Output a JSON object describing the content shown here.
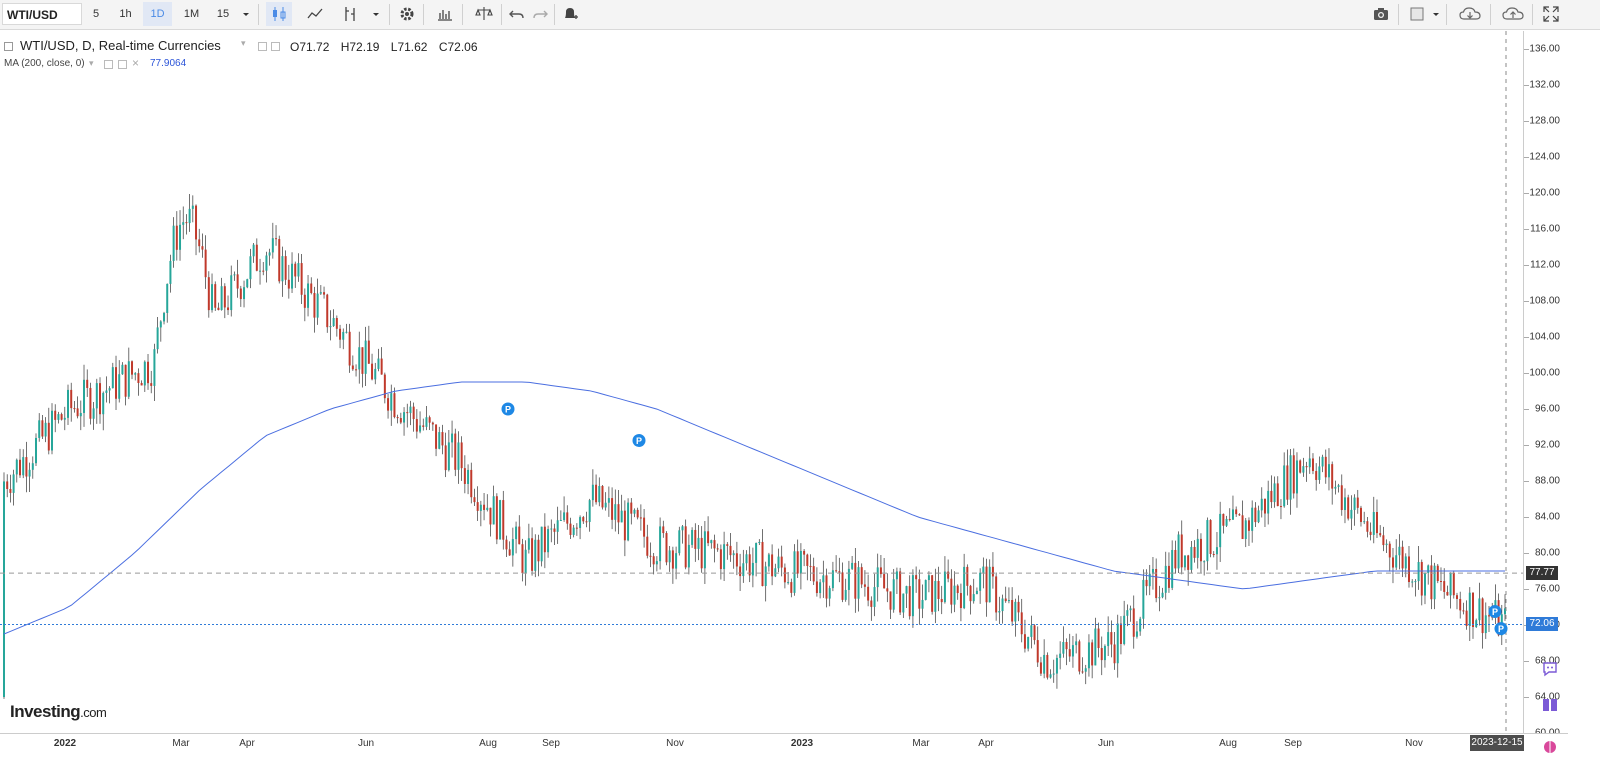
{
  "toolbar": {
    "symbol": "WTI/USD",
    "intervals": [
      "5",
      "1h",
      "1D",
      "1M",
      "15"
    ],
    "selected_interval": "1D"
  },
  "legend": {
    "title": "WTI/USD, D, Real-time Currencies",
    "open": "O71.72",
    "high": "H72.19",
    "low": "L71.62",
    "close": "C72.06",
    "ma_label": "MA (200, close, 0)",
    "ma_value": "77.9064"
  },
  "colors": {
    "up": "#26a69a",
    "down": "#c0392b",
    "ma": "#4a6ee0",
    "accent": "#2f7bd8"
  },
  "y_axis": {
    "labels": [
      "136.00",
      "132.00",
      "128.00",
      "124.00",
      "120.00",
      "116.00",
      "112.00",
      "108.00",
      "104.00",
      "100.00",
      "96.00",
      "92.00",
      "88.00",
      "84.00",
      "80.00",
      "76.00",
      "72.00",
      "68.00",
      "64.00",
      "60.00"
    ],
    "min": 60,
    "max": 138
  },
  "x_axis": {
    "labels": [
      {
        "text": "2022",
        "bold": true
      },
      {
        "text": "Mar",
        "bold": false
      },
      {
        "text": "Apr",
        "bold": false
      },
      {
        "text": "Jun",
        "bold": false
      },
      {
        "text": "Aug",
        "bold": false
      },
      {
        "text": "Sep",
        "bold": false
      },
      {
        "text": "Nov",
        "bold": false
      },
      {
        "text": "2023",
        "bold": true
      },
      {
        "text": "Mar",
        "bold": false
      },
      {
        "text": "Apr",
        "bold": false
      },
      {
        "text": "Jun",
        "bold": false
      },
      {
        "text": "Aug",
        "bold": false
      },
      {
        "text": "Sep",
        "bold": false
      },
      {
        "text": "Nov",
        "bold": false
      }
    ],
    "cursor_date": "2023-12-15"
  },
  "price_tags": {
    "ma": "77.77",
    "last": "72.06"
  },
  "branding": {
    "logo": "Investing",
    "logo_suffix": ".com"
  },
  "icons": [
    "candle-style-icon",
    "line-style-icon",
    "indicators-icon",
    "settings-icon",
    "studies-icon",
    "compare-icon",
    "undo-icon",
    "redo-icon",
    "alert-icon",
    "camera-icon",
    "color-icon",
    "cloud-load-icon",
    "cloud-save-icon",
    "fullscreen-icon"
  ],
  "chart_data": {
    "type": "candlestick",
    "title": "WTI/USD",
    "xlabel": "",
    "ylabel": "",
    "ylim": [
      60,
      138
    ],
    "x": [
      "2022-01",
      "2022-02",
      "2022-03",
      "2022-04",
      "2022-05",
      "2022-06",
      "2022-07",
      "2022-08",
      "2022-09",
      "2022-10",
      "2022-11",
      "2022-12",
      "2023-01",
      "2023-02",
      "2023-03",
      "2023-04",
      "2023-05",
      "2023-06",
      "2023-07",
      "2023-08",
      "2023-09",
      "2023-10",
      "2023-11",
      "2023-12"
    ],
    "close_approx": [
      88,
      96,
      100,
      104,
      114,
      106,
      97,
      90,
      79,
      86,
      81,
      80,
      78,
      77,
      75,
      77,
      68,
      70,
      80,
      83,
      91,
      82,
      76,
      72
    ],
    "series": [
      {
        "name": "WTI/USD",
        "type": "candles"
      },
      {
        "name": "MA (200, close, 0)",
        "values_approx": [
          71,
          74,
          80,
          87,
          93,
          96,
          98,
          99,
          99,
          98,
          96,
          93,
          90,
          87,
          84,
          82,
          80,
          78,
          77,
          76,
          77,
          78,
          78,
          78
        ]
      }
    ]
  }
}
